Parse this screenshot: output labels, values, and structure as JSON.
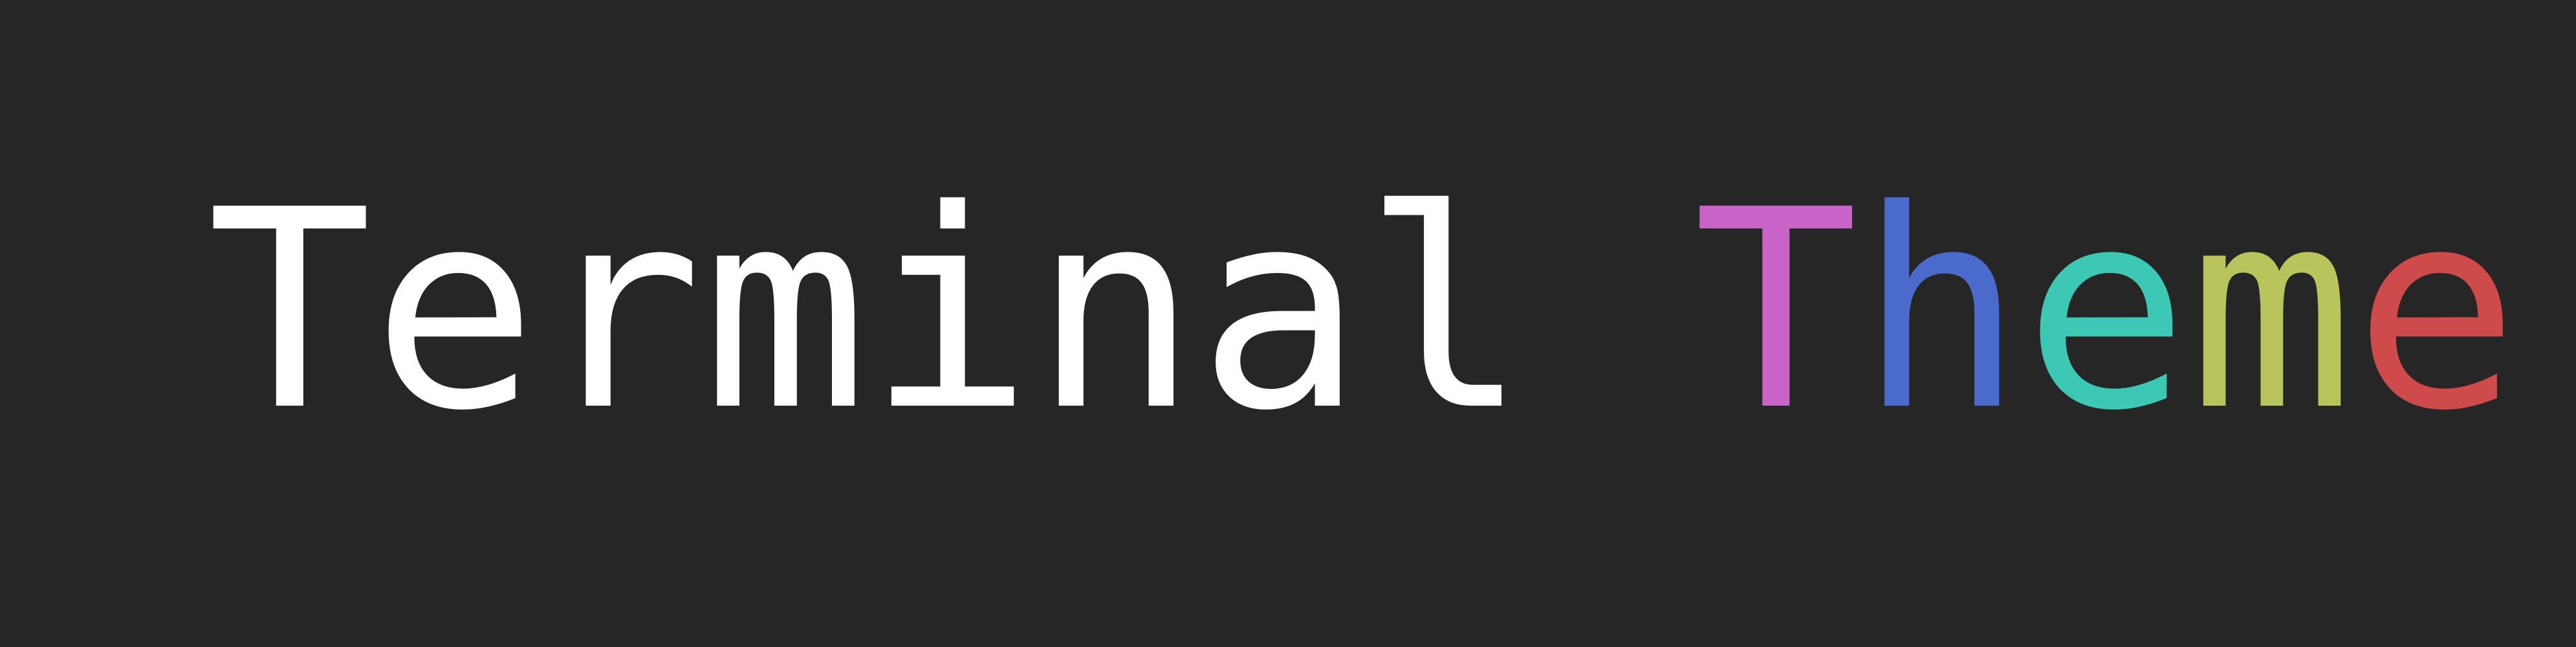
{
  "banner": {
    "background_color": "#262626",
    "word1": {
      "text": "Terminal",
      "color": "#ffffff"
    },
    "word2": {
      "letters": [
        {
          "char": "T",
          "color": "#c864c8"
        },
        {
          "char": "h",
          "color": "#4a6bcc"
        },
        {
          "char": "e",
          "color": "#3cc8b4"
        },
        {
          "char": "m",
          "color": "#b9c45c"
        },
        {
          "char": "e",
          "color": "#cf4a4a"
        }
      ]
    }
  }
}
